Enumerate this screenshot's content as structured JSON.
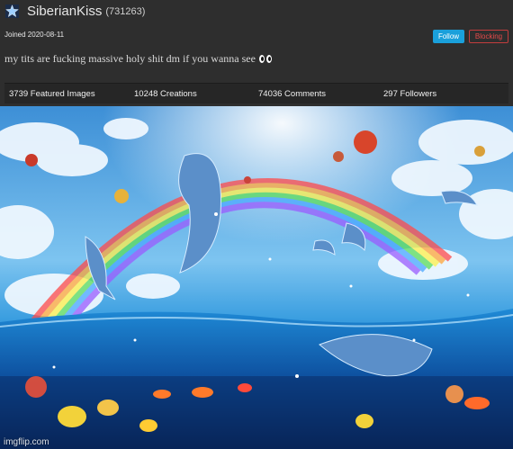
{
  "profile": {
    "username": "SiberianKiss",
    "user_id": "(731263)",
    "joined": "Joined 2020-08-11",
    "bio": "my tits are fucking massive holy shit dm if you wanna see",
    "bio_emoji": "eyes-emoji"
  },
  "actions": {
    "follow_label": "Follow",
    "blocking_label": "Blocking"
  },
  "stats": {
    "featured": "3739 Featured Images",
    "creations": "10248 Creations",
    "comments": "74036 Comments",
    "followers": "297 Followers"
  },
  "banner": {
    "description_icon": "ocean-dolphins-rainbow-artwork"
  },
  "watermark": "imgflip.com",
  "colors": {
    "background": "#2e2e2e",
    "follow": "#1aa0db",
    "blocking": "#e34a4a",
    "stats_bar": "#262626"
  }
}
